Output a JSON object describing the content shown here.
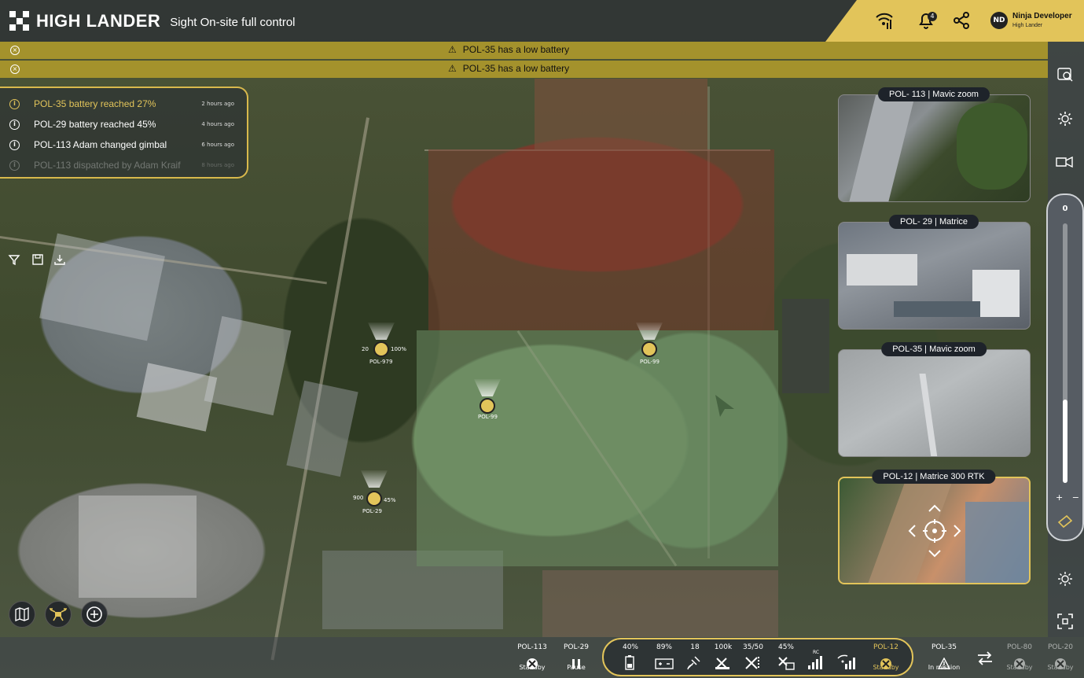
{
  "header": {
    "brand": "HIGH LANDER",
    "subtitle": "Sight On-site full control",
    "notification_count": "4",
    "user_initials": "ND",
    "user_name": "Ninja Developer",
    "user_role": "High Lander"
  },
  "alerts": [
    {
      "message": "POL-35 has a low battery"
    },
    {
      "message": "POL-35 has a low battery"
    }
  ],
  "notifications": [
    {
      "text": "POL-35 battery reached 27%",
      "time": "2 hours ago",
      "highlight": true
    },
    {
      "text": "POL-29 battery reached 45%",
      "time": "4 hours ago"
    },
    {
      "text": "POL-113 Adam changed gimbal",
      "time": "6 hours ago"
    },
    {
      "text": "POL-113 dispatched by Adam Kraif",
      "time": "8 hours ago",
      "faded": true
    }
  ],
  "drones": [
    {
      "id": "POL-979",
      "left": "20",
      "right": "100%"
    },
    {
      "id": "POL-99",
      "left": "",
      "right": ""
    },
    {
      "id": "POL-99",
      "left": "",
      "right": ""
    },
    {
      "id": "POL-29",
      "left": "900",
      "right": "45%"
    }
  ],
  "feeds": [
    {
      "drone": "POL- 113",
      "camera": "Mavic zoom"
    },
    {
      "drone": "POL- 29",
      "camera": "Matrice"
    },
    {
      "drone": "POL-35",
      "camera": "Mavic zoom"
    },
    {
      "drone": "POL-12",
      "camera": "Matrice 300 RTK"
    }
  ],
  "zoom": {
    "value": "0",
    "level": 0.32,
    "plus": "+",
    "minus": "−"
  },
  "bottom_left": [
    {
      "id": "POL-113",
      "status": "Standby"
    },
    {
      "id": "POL-29",
      "status": "Pause"
    }
  ],
  "status_values": {
    "battery": "40%",
    "battery2": "89%",
    "satellites": "18",
    "distance": "100k",
    "ratio": "35/50",
    "storage": "45%",
    "rc": "RC"
  },
  "active_drone": {
    "id": "POL-12",
    "status": "Standby"
  },
  "bottom_right": [
    {
      "id": "POL-35",
      "status": "In mission"
    },
    {
      "id": "POL-80",
      "status": "Standby"
    },
    {
      "id": "POL-20",
      "status": "Standby"
    }
  ],
  "colors": {
    "accent": "#e2c45a",
    "dark": "#1e232a"
  }
}
